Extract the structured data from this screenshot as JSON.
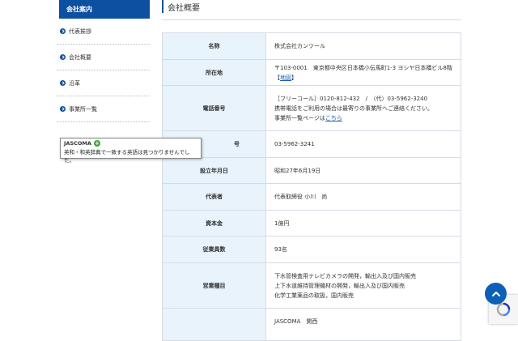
{
  "sidebar": {
    "heading": "会社案内",
    "items": [
      {
        "label": "代表挨拶"
      },
      {
        "label": "会社概要"
      },
      {
        "label": "沿革"
      },
      {
        "label": "事業所一覧"
      }
    ]
  },
  "tooltip": {
    "title": "JASCOMA",
    "plus": "+",
    "body": "英和・和英辞典で一致する英語は見つかりませんでした。"
  },
  "main": {
    "heading": "会社概要",
    "rows": {
      "name": {
        "label": "名称",
        "value": "株式会社カンツール"
      },
      "address": {
        "label": "所在地",
        "value": "〒103-0001　東京都中央区日本橋小伝馬町1-3 ヨシヤ日本橋ビル8階",
        "link_open": "【",
        "link": "地図",
        "link_close": "】"
      },
      "phone": {
        "label": "電話番号",
        "line1": "［フリーコール］0120-812-432　/　（代）03-5962-3240",
        "line2": "携帯電話をご利用の場合は最寄りの事業所へご連絡ください。",
        "line3_prefix": "事業所一覧ページは",
        "line3_link": "こちら"
      },
      "fax": {
        "label": "号",
        "value": "03-5962-3241"
      },
      "established": {
        "label": "設立年月日",
        "value": "昭和27年6月19日"
      },
      "representative": {
        "label": "代表者",
        "value": "代表取締役 小川　尚"
      },
      "capital": {
        "label": "資本金",
        "value": "1億円"
      },
      "employees": {
        "label": "従業員数",
        "value": "93名"
      },
      "business": {
        "label": "営業種目",
        "lines": [
          "下水管検査用テレビカメラの開発，輸出入及び国内販売",
          "上下水道維持管理機材の開発，輸出入及び国内販売",
          "化学工業薬品の取扱，国内販売"
        ]
      },
      "membership": {
        "label": "",
        "value": "JASCOMA　関西"
      }
    }
  },
  "icons": {
    "back_to_top": "chevron-up-icon",
    "recaptcha": "recaptcha-icon"
  },
  "colors": {
    "brand_blue": "#0d4fa0",
    "header_cell_bg": "#e8f3fc",
    "link": "#1a5db5"
  }
}
